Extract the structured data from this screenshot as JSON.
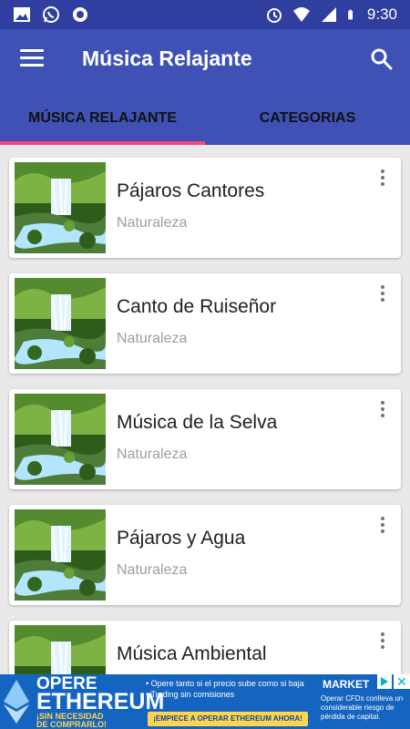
{
  "status_bar": {
    "time": "9:30",
    "icons": [
      "image-icon",
      "whatsapp-icon",
      "circle-app-icon",
      "alarm-icon",
      "wifi-icon",
      "signal-icon",
      "battery-icon"
    ]
  },
  "app_bar": {
    "title": "Música Relajante",
    "menu_icon": "hamburger-menu-icon",
    "search_icon": "search-icon"
  },
  "colors": {
    "primary": "#3f51b5",
    "primary_dark": "#303f9f",
    "accent": "#ff4081"
  },
  "tabs": [
    {
      "label": "MÚSICA RELAJANTE",
      "active": true
    },
    {
      "label": "CATEGORIAS",
      "active": false
    }
  ],
  "tracks": [
    {
      "title": "Pájaros Cantores",
      "category": "Naturaleza"
    },
    {
      "title": "Canto de Ruiseñor",
      "category": "Naturaleza"
    },
    {
      "title": "Música de la Selva",
      "category": "Naturaleza"
    },
    {
      "title": "Pájaros y Agua",
      "category": "Naturaleza"
    },
    {
      "title": "Música Ambiental",
      "category": ""
    }
  ],
  "ad": {
    "line1": "OPERE",
    "line2": "ETHEREUM",
    "line3": "¡SIN NECESIDAD",
    "line4": "DE COMPRARLO!",
    "bullet1": "Opere tanto si el precio sube como si baja",
    "bullet2": "Trading sin comisiones",
    "cta": "¡EMPIECE A OPERAR ETHEREUM AHORA!",
    "brand": "MARKET",
    "disclaimer": "Operar CFDs conlleva un considerable riesgo de pérdida de capital."
  }
}
